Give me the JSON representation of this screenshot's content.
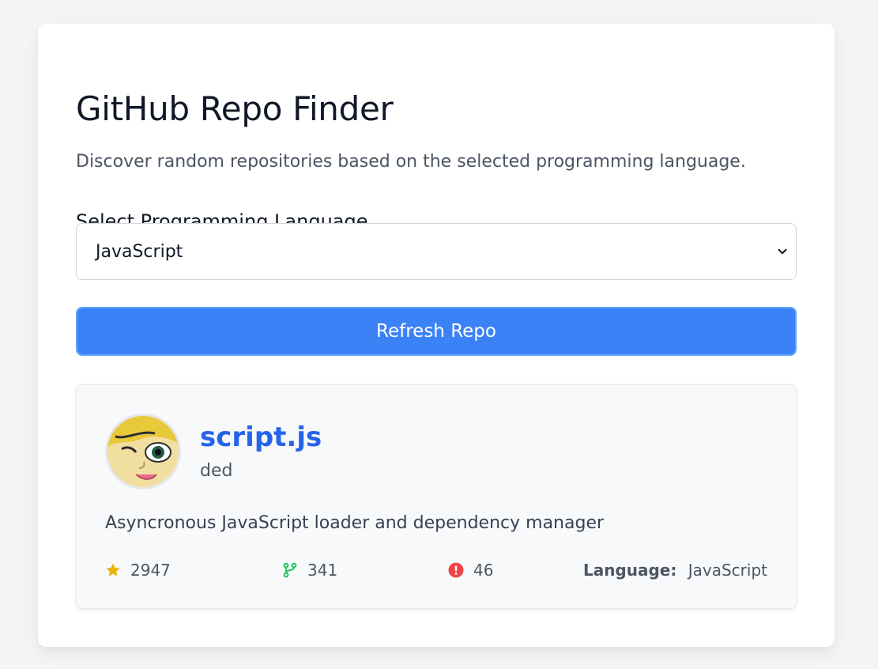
{
  "header": {
    "title": "GitHub Repo Finder",
    "subtitle": "Discover random repositories based on the selected programming language."
  },
  "language_select": {
    "label": "Select Programming Language",
    "selected": "JavaScript"
  },
  "refresh_button": {
    "label": "Refresh Repo"
  },
  "repo": {
    "name": "script.js",
    "owner": "ded",
    "description": "Asyncronous JavaScript loader and dependency manager",
    "stars": "2947",
    "forks": "341",
    "issues": "46",
    "language_label": "Language:",
    "language": "JavaScript"
  },
  "icons": {
    "star": "star-icon",
    "fork": "fork-icon",
    "issue": "issue-icon",
    "chevron": "chevron-down-icon"
  },
  "colors": {
    "accent": "#3b82f6",
    "link": "#2563eb",
    "star": "#eab308",
    "fork": "#22c55e",
    "issue": "#ef4444"
  }
}
